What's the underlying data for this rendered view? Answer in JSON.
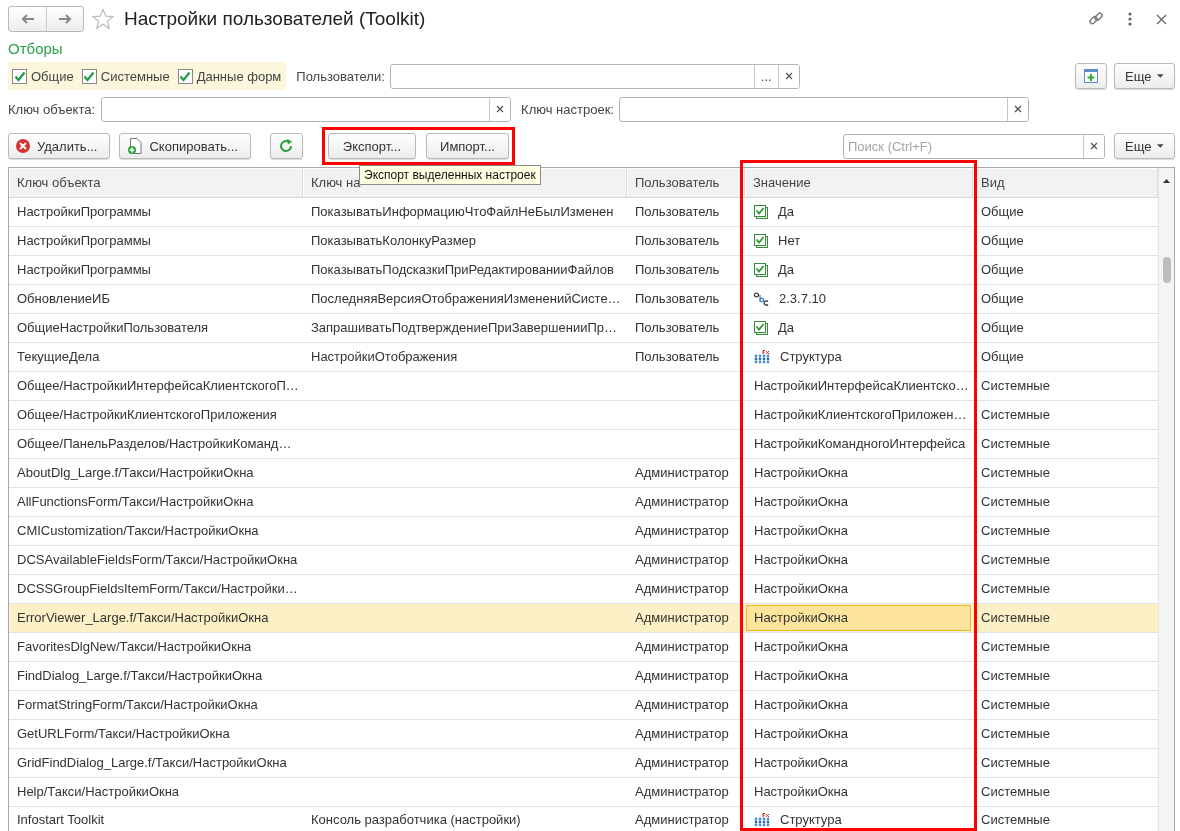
{
  "window": {
    "title": "Настройки пользователей (Toolkit)"
  },
  "filters": {
    "title": "Отборы",
    "checkboxes": [
      {
        "label": "Общие",
        "checked": true
      },
      {
        "label": "Системные",
        "checked": true
      },
      {
        "label": "Данные форм",
        "checked": true
      }
    ],
    "users_label": "Пользователи:",
    "select_button": "...",
    "more_button": "Еще",
    "object_key_label": "Ключ объекта:",
    "settings_key_label": "Ключ настроек:"
  },
  "toolbar": {
    "delete_button": "Удалить...",
    "copy_button": "Скопировать...",
    "export_button": "Экспорт...",
    "import_button": "Импорт...",
    "search": {
      "placeholder": "Поиск (Ctrl+F)"
    },
    "more_button": "Еще"
  },
  "tooltip": "Экспорт выделенных настроек",
  "table": {
    "columns": [
      "Ключ объекта",
      "Ключ на",
      "Пользователь",
      "Значение",
      "Вид"
    ],
    "rows": [
      {
        "object_key": "НастройкиПрограммы",
        "settings_key": "ПоказыватьИнформациюЧтоФайлНеБылИзменен",
        "user": "Пользователь",
        "value": "Да",
        "kind": "boolean",
        "type": "Общие",
        "selected": false,
        "value_focused": false
      },
      {
        "object_key": "НастройкиПрограммы",
        "settings_key": "ПоказыватьКолонкуРазмер",
        "user": "Пользователь",
        "value": "Нет",
        "kind": "boolean",
        "type": "Общие",
        "selected": false,
        "value_focused": false
      },
      {
        "object_key": "НастройкиПрограммы",
        "settings_key": "ПоказыватьПодсказкиПриРедактированииФайлов",
        "user": "Пользователь",
        "value": "Да",
        "kind": "boolean",
        "type": "Общие",
        "selected": false,
        "value_focused": false
      },
      {
        "object_key": "ОбновлениеИБ",
        "settings_key": "ПоследняяВерсияОтображенияИзмененийСисте…",
        "user": "Пользователь",
        "value": "2.3.7.10",
        "kind": "string",
        "type": "Общие",
        "selected": false,
        "value_focused": false
      },
      {
        "object_key": "ОбщиеНастройкиПользователя",
        "settings_key": "ЗапрашиватьПодтверждениеПриЗавершенииПр…",
        "user": "Пользователь",
        "value": "Да",
        "kind": "boolean",
        "type": "Общие",
        "selected": false,
        "value_focused": false
      },
      {
        "object_key": "ТекущиеДела",
        "settings_key": "НастройкиОтображения",
        "user": "Пользователь",
        "value": "Структура",
        "kind": "structure",
        "type": "Общие",
        "selected": false,
        "value_focused": false
      },
      {
        "object_key": "Общее/НастройкиИнтерфейсаКлиентскогоП…",
        "value": "НастройкиИнтерфейсаКлиентско…",
        "kind": "plain",
        "type": "Системные",
        "selected": false,
        "value_focused": false
      },
      {
        "object_key": "Общее/НастройкиКлиентскогоПриложения",
        "value": "НастройкиКлиентскогоПриложен…",
        "kind": "plain",
        "type": "Системные",
        "selected": false,
        "value_focused": false
      },
      {
        "object_key": "Общее/ПанельРазделов/НастройкиКоманд…",
        "value": "НастройкиКомандногоИнтерфейса",
        "kind": "plain",
        "type": "Системные",
        "selected": false,
        "value_focused": false
      },
      {
        "object_key": "AboutDlg_Large.f/Такси/НастройкиОкна",
        "user": "Администратор",
        "value": "НастройкиОкна",
        "kind": "plain",
        "type": "Системные",
        "selected": false,
        "value_focused": false
      },
      {
        "object_key": "AllFunctionsForm/Такси/НастройкиОкна",
        "user": "Администратор",
        "value": "НастройкиОкна",
        "kind": "plain",
        "type": "Системные",
        "selected": false,
        "value_focused": false
      },
      {
        "object_key": "CMICustomization/Такси/НастройкиОкна",
        "user": "Администратор",
        "value": "НастройкиОкна",
        "kind": "plain",
        "type": "Системные",
        "selected": false,
        "value_focused": false
      },
      {
        "object_key": "DCSAvailableFieldsForm/Такси/НастройкиОкна",
        "user": "Администратор",
        "value": "НастройкиОкна",
        "kind": "plain",
        "type": "Системные",
        "selected": false,
        "value_focused": false
      },
      {
        "object_key": "DCSSGroupFieldsItemForm/Такси/Настройки…",
        "user": "Администратор",
        "value": "НастройкиОкна",
        "kind": "plain",
        "type": "Системные",
        "selected": false,
        "value_focused": false
      },
      {
        "object_key": "ErrorViewer_Large.f/Такси/НастройкиОкна",
        "user": "Администратор",
        "value": "НастройкиОкна",
        "kind": "plain",
        "type": "Системные",
        "selected": true,
        "value_focused": true
      },
      {
        "object_key": "FavoritesDlgNew/Такси/НастройкиОкна",
        "user": "Администратор",
        "value": "НастройкиОкна",
        "kind": "plain",
        "type": "Системные",
        "selected": false,
        "value_focused": false
      },
      {
        "object_key": "FindDialog_Large.f/Такси/НастройкиОкна",
        "user": "Администратор",
        "value": "НастройкиОкна",
        "kind": "plain",
        "type": "Системные",
        "selected": false,
        "value_focused": false
      },
      {
        "object_key": "FormatStringForm/Такси/НастройкиОкна",
        "user": "Администратор",
        "value": "НастройкиОкна",
        "kind": "plain",
        "type": "Системные",
        "selected": false,
        "value_focused": false
      },
      {
        "object_key": "GetURLForm/Такси/НастройкиОкна",
        "user": "Администратор",
        "value": "НастройкиОкна",
        "kind": "plain",
        "type": "Системные",
        "selected": false,
        "value_focused": false
      },
      {
        "object_key": "GridFindDialog_Large.f/Такси/НастройкиОкна",
        "user": "Администратор",
        "value": "НастройкиОкна",
        "kind": "plain",
        "type": "Системные",
        "selected": false,
        "value_focused": false
      },
      {
        "object_key": "Help/Такси/НастройкиОкна",
        "user": "Администратор",
        "value": "НастройкиОкна",
        "kind": "plain",
        "type": "Системные",
        "selected": false,
        "value_focused": false
      },
      {
        "object_key": "Infostart Toolkit",
        "settings_key": "Консоль разработчика (настройки)",
        "user": "Администратор",
        "value": "Структура",
        "kind": "structure",
        "type": "Системные",
        "selected": false,
        "value_focused": false
      }
    ]
  }
}
